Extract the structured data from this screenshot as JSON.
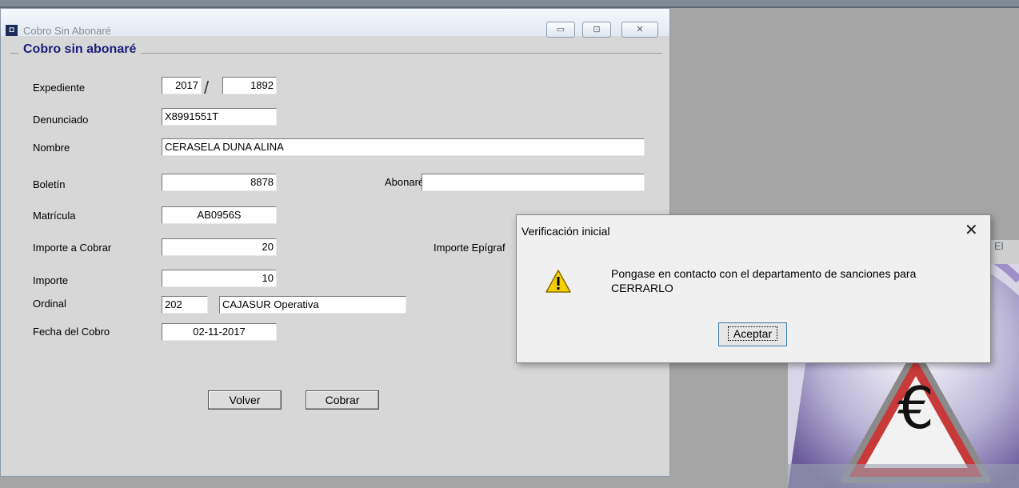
{
  "window": {
    "title": "Cobro Sin Abonaré",
    "group_title": "Cobro sin abonaré",
    "controls": {
      "minimize": "▭",
      "maximize": "⊡",
      "close": "✕"
    }
  },
  "form": {
    "expediente": {
      "label": "Expediente",
      "year": "2017",
      "number": "1892"
    },
    "denunciado": {
      "label": "Denunciado",
      "value": "X8991551T"
    },
    "nombre": {
      "label": "Nombre",
      "value": "CERASELA  DUNA ALINA"
    },
    "boletin": {
      "label": "Boletín",
      "value": "8878"
    },
    "abonare": {
      "label": "Abonaré",
      "value": ""
    },
    "matricula": {
      "label": "Matrícula",
      "value": "AB0956S"
    },
    "importe_cobrar": {
      "label": "Importe a Cobrar",
      "value": "20"
    },
    "importe_epigrafe": {
      "label": "Importe Epígraf"
    },
    "importe": {
      "label": "Importe",
      "value": "10"
    },
    "ordinal": {
      "label": "Ordinal",
      "code": "202",
      "name": "CAJASUR Operativa"
    },
    "fecha_cobro": {
      "label": "Fecha del Cobro",
      "value": "02-11-2017"
    }
  },
  "buttons": {
    "volver": "Volver",
    "cobrar": "Cobrar"
  },
  "dialog": {
    "title": "Verificación inicial",
    "close": "✕",
    "message": "Pongase en contacto con el departamento de sanciones para CERRARLO",
    "ok_label": "Aceptar",
    "icon": "warning-icon"
  },
  "background_app": {
    "title_fragment": "s - El"
  }
}
